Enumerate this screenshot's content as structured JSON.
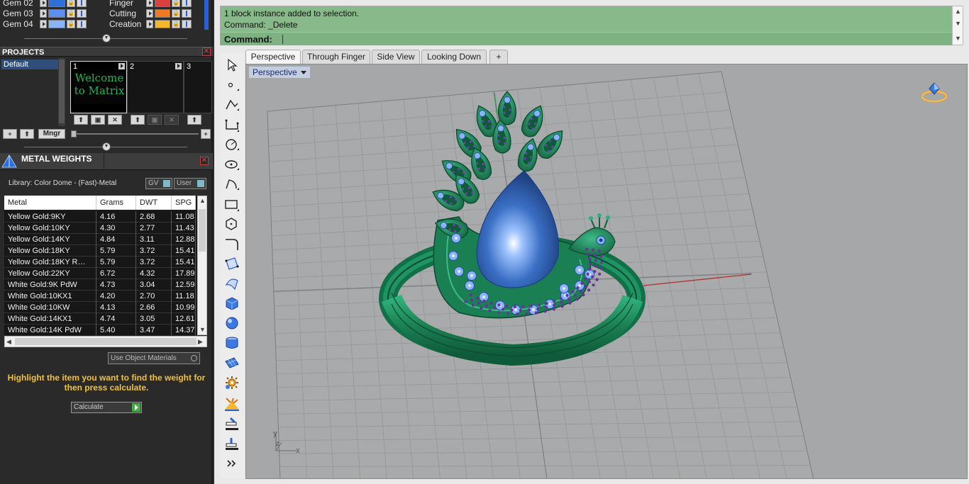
{
  "layers": {
    "left_rows": [
      {
        "label": "Gem 02",
        "color": "#2f6fd8"
      },
      {
        "label": "Gem 03",
        "color": "#5b8ff0"
      },
      {
        "label": "Gem 04",
        "color": "#8ab4f8"
      }
    ],
    "right_rows": [
      {
        "label": "Finger",
        "color": "#d94040"
      },
      {
        "label": "Cutting",
        "color": "#f07a22"
      },
      {
        "label": "Creation",
        "color": "#f5b82a"
      }
    ]
  },
  "projects": {
    "title": "PROJECTS",
    "list_item": "Default",
    "slots": [
      "1",
      "2",
      "3"
    ],
    "welcome_text": "Welcome to Matrix",
    "manager_label": "Mngr"
  },
  "metal_weights": {
    "title": "METAL WEIGHTS",
    "library": "Library: Color Dome - (Fast)-Metal",
    "gv_label": "GV",
    "user_label": "User",
    "columns": [
      "Metal",
      "Grams",
      "DWT",
      "SPG"
    ],
    "rows": [
      [
        "Yellow Gold:9KY",
        "4.16",
        "2.68",
        "11.08"
      ],
      [
        "Yellow Gold:10KY",
        "4.30",
        "2.77",
        "11.43"
      ],
      [
        "Yellow Gold:14KY",
        "4.84",
        "3.11",
        "12.88"
      ],
      [
        "Yellow Gold:18KY",
        "5.79",
        "3.72",
        "15.41"
      ],
      [
        "Yellow Gold:18KY R…",
        "5.79",
        "3.72",
        "15.41"
      ],
      [
        "Yellow Gold:22KY",
        "6.72",
        "4.32",
        "17.89"
      ],
      [
        "White Gold:9K PdW",
        "4.73",
        "3.04",
        "12.59"
      ],
      [
        "White Gold:10KX1",
        "4.20",
        "2.70",
        "11.18"
      ],
      [
        "White Gold:10KW",
        "4.13",
        "2.66",
        "10.99"
      ],
      [
        "White Gold:14KX1",
        "4.74",
        "3.05",
        "12.61"
      ],
      [
        "White Gold:14K PdW",
        "5.40",
        "3.47",
        "14.37"
      ]
    ],
    "use_object_materials": "Use Object Materials",
    "hint": "Highlight the item you want to find the weight for then press calculate.",
    "calculate": "Calculate"
  },
  "command": {
    "line1": "1 block instance added to selection.",
    "line2": "Command: _Delete",
    "prompt": "Command:"
  },
  "viewport_tabs": [
    "Perspective",
    "Through Finger",
    "Side View",
    "Looking Down"
  ],
  "viewport": {
    "label": "Perspective",
    "axis_y": "y",
    "axis_z": "z",
    "axis_x": "x"
  },
  "colors": {
    "command_bg": "#87b98a",
    "viewport_bg": "#a6a7a8",
    "ring_green": "#1e8f5e",
    "gem_blue": "#3a6fc4",
    "pave_purple": "#6a2fa0",
    "hint_yellow": "#f2c13c"
  }
}
